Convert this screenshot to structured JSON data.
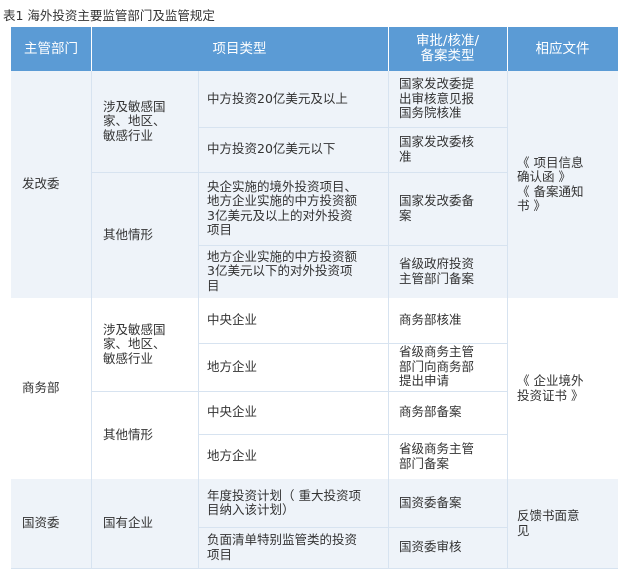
{
  "caption": "表1  海外投资主要监管部门及监管规定",
  "headers": [
    "主管部门",
    "项目类型",
    "审批/核准/备案类型",
    "相应文件"
  ],
  "header_lines": {
    "approval": [
      "审批/核准/",
      "备案类型"
    ]
  },
  "groups": [
    {
      "dept": "发改委",
      "subgroups": [
        {
          "category": [
            "涉及敏感国",
            "家、地区、",
            "敏感行业"
          ],
          "rows": [
            {
              "project": [
                "中方投资20亿美元及以上"
              ],
              "approval": [
                "国家发改委提",
                "出审核意见报",
                "国务院核准"
              ]
            },
            {
              "project": [
                "中方投资20亿美元以下"
              ],
              "approval": [
                "国家发改委核",
                "准"
              ]
            }
          ]
        },
        {
          "category": [
            "其他情形"
          ],
          "rows": [
            {
              "project": [
                "央企实施的境外投资项目、",
                "地方企业实施的中方投资额",
                "3亿美元及以上的对外投资",
                "项目"
              ],
              "approval": [
                "国家发改委备",
                "案"
              ]
            },
            {
              "project": [
                "地方企业实施的中方投资额",
                "3亿美元以下的对外投资项",
                "目"
              ],
              "approval": [
                "省级政府投资",
                "主管部门备案"
              ]
            }
          ]
        }
      ],
      "documents": [
        "《 项目信息",
        "确认函 》",
        "《 备案通知",
        "书 》"
      ]
    },
    {
      "dept": "商务部",
      "subgroups": [
        {
          "category": [
            "涉及敏感国",
            "家、地区、",
            "敏感行业"
          ],
          "rows": [
            {
              "project": [
                "中央企业"
              ],
              "approval": [
                "商务部核准"
              ]
            },
            {
              "project": [
                "地方企业"
              ],
              "approval": [
                "省级商务主管",
                "部门向商务部",
                "提出申请"
              ]
            }
          ]
        },
        {
          "category": [
            "其他情形"
          ],
          "rows": [
            {
              "project": [
                "中央企业"
              ],
              "approval": [
                "商务部备案"
              ]
            },
            {
              "project": [
                "地方企业"
              ],
              "approval": [
                "省级商务主管",
                "部门备案"
              ]
            }
          ]
        }
      ],
      "documents": [
        "《 企业境外",
        "投资证书 》"
      ]
    },
    {
      "dept": "国资委",
      "subgroups": [
        {
          "category": [
            "国有企业"
          ],
          "rows": [
            {
              "project": [
                "年度投资计划（ 重大投资项",
                "目纳入该计划）"
              ],
              "approval": [
                "国资委备案"
              ]
            },
            {
              "project": [
                "负面清单特别监管类的投资",
                "项目"
              ],
              "approval": [
                "国资委审核"
              ]
            }
          ]
        }
      ],
      "documents": [
        "反馈书面意",
        "见"
      ]
    }
  ],
  "colors": {
    "header_bg": "#5b9bd5",
    "band_bg": "#eef3f9",
    "grid": "#d7e3f0",
    "text": "#333333"
  }
}
